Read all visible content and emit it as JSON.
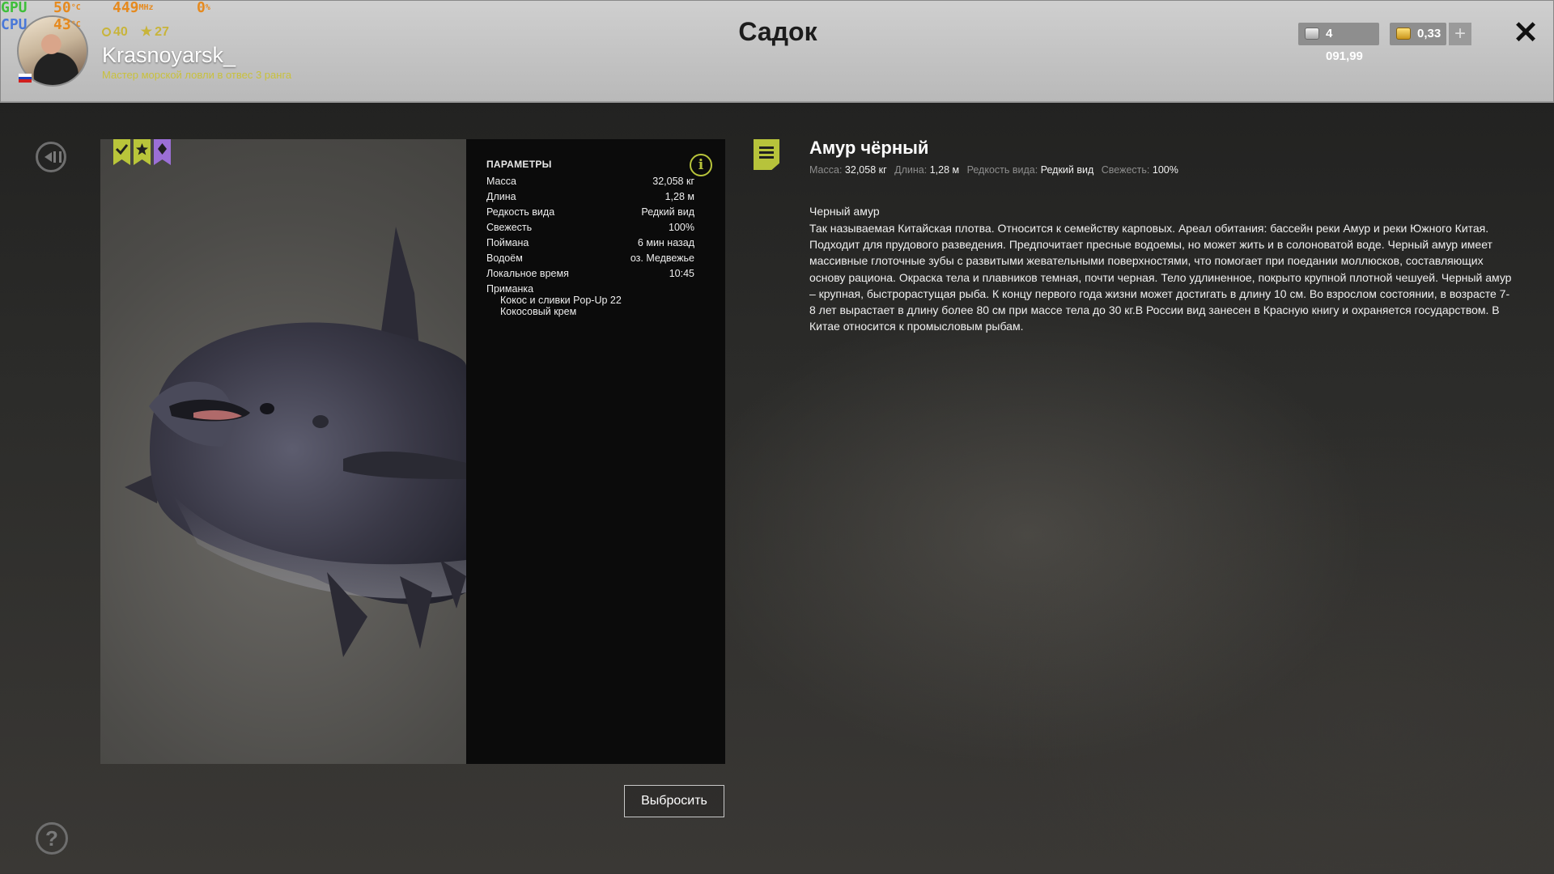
{
  "overlay": {
    "gpu_label": "GPU",
    "gpu_temp": "50",
    "gpu_temp_unit": "°C",
    "gpu_clock": "449",
    "gpu_clock_unit": "MHz",
    "gpu_load": "0",
    "gpu_load_unit": "%",
    "cpu_label": "CPU",
    "cpu_temp": "43",
    "cpu_temp_unit": "°C"
  },
  "header": {
    "title": "Садок",
    "player": {
      "level": "40",
      "stars": "27",
      "name": "Krasnoyarsk_",
      "rank": "Мастер морской ловли в отвес 3 ранга",
      "flag_colors": [
        "#ffffff",
        "#1c3fbf",
        "#d02020"
      ]
    },
    "silver": "4 091,99",
    "gold": "0,33",
    "plus_label": "+",
    "close_label": "✕"
  },
  "badges": [
    {
      "icon": "check-badge-icon",
      "color": "#b9c53a"
    },
    {
      "icon": "star-badge-icon",
      "color": "#b9c53a"
    },
    {
      "icon": "diamond-badge-icon",
      "color": "#9b6fd6"
    }
  ],
  "params": {
    "title": "ПАРАМЕТРЫ",
    "rows": [
      {
        "label": "Масса",
        "value": "32,058 кг"
      },
      {
        "label": "Длина",
        "value": "1,28 м"
      },
      {
        "label": "Редкость вида",
        "value": "Редкий вид"
      },
      {
        "label": "Свежесть",
        "value": "100%"
      },
      {
        "label": "Поймана",
        "value": "6 мин назад"
      },
      {
        "label": "Водоём",
        "value": "оз. Медвежье"
      },
      {
        "label": "Локальное время",
        "value": "10:45"
      }
    ],
    "bait_label": "Приманка",
    "bait_items": [
      "Кокос и сливки Pop-Up 22",
      "Кокосовый крем"
    ]
  },
  "discard_label": "Выбросить",
  "fish": {
    "name": "Амур чёрный",
    "meta": [
      {
        "label": "Масса:",
        "value": "32,058 кг"
      },
      {
        "label": "Длина:",
        "value": "1,28 м"
      },
      {
        "label": "Редкость вида:",
        "value": "Редкий вид"
      },
      {
        "label": "Свежесть:",
        "value": "100%"
      }
    ],
    "desc_title": "Черный амур",
    "desc_text": "Так называемая Китайская плотва. Относится к семейству карповых. Ареал обитания: бассейн реки Амур и реки Южного Китая. Подходит для прудового разведения. Предпочитает пресные водоемы, но может жить и в солоноватой воде. Черный амур имеет массивные глоточные зубы с развитыми жевательными поверхностями, что помогает при поедании моллюсков, составляющих основу рациона. Окраска тела и плавников темная, почти черная. Тело удлиненное, покрыто крупной плотной чешуей. Черный амур – крупная, быстрорастущая рыба. К концу первого года жизни может достигать в длину 10 см. Во взрослом состоянии, в возрасте 7-8 лет вырастает в длину более 80 см при массе тела до 30 кг.В России вид занесен в Красную книгу и охраняется государством. В Китае относится к промысловым рыбам."
  },
  "colors": {
    "accent": "#b7c33b",
    "header_bg": "#c4c4c4",
    "panel_bg": "#0b0b0b"
  }
}
